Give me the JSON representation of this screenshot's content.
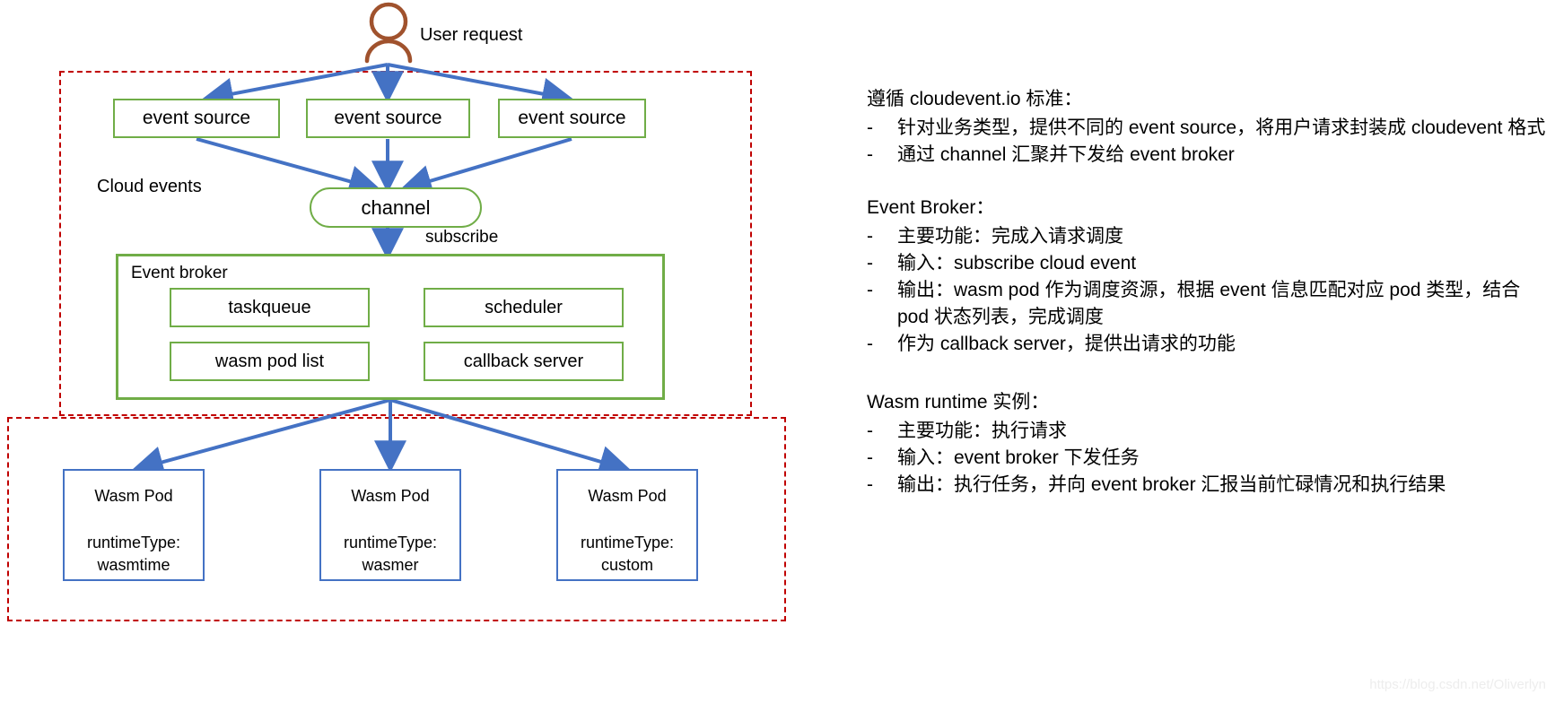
{
  "diagram": {
    "user_label": "User request",
    "cloud_events_label": "Cloud events",
    "subscribe_label": "subscribe",
    "event_sources": [
      "event source",
      "event source",
      "event source"
    ],
    "channel_label": "channel",
    "broker": {
      "title": "Event broker",
      "components": [
        "taskqueue",
        "scheduler",
        "wasm pod list",
        "callback server"
      ]
    },
    "pods": [
      {
        "title": "Wasm Pod",
        "runtime_key": "runtimeType:",
        "runtime_value": "wasmtime"
      },
      {
        "title": "Wasm Pod",
        "runtime_key": "runtimeType:",
        "runtime_value": "wasmer"
      },
      {
        "title": "Wasm Pod",
        "runtime_key": "runtimeType:",
        "runtime_value": "custom"
      }
    ]
  },
  "notes": {
    "sections": [
      {
        "heading": "遵循 cloudevent.io 标准：",
        "bullets": [
          {
            "marker": "-",
            "text": "针对业务类型，提供不同的 event source，将用户请求封装成 cloudevent 格式"
          },
          {
            "marker": "-",
            "text": "通过 channel 汇聚并下发给 event broker"
          }
        ]
      },
      {
        "heading": "Event Broker：",
        "bullets": [
          {
            "marker": "-",
            "text": "主要功能：完成入请求调度"
          },
          {
            "marker": "-",
            "text": "输入：subscribe cloud event"
          },
          {
            "marker": "-",
            "text": "输出：wasm pod 作为调度资源，根据 event 信息匹配对应 pod 类型，结合 pod 状态列表，完成调度"
          },
          {
            "marker": "-",
            "text": "作为 callback server，提供出请求的功能"
          }
        ]
      },
      {
        "heading": "Wasm runtime 实例：",
        "bullets": [
          {
            "marker": "-",
            "text": "主要功能：执行请求"
          },
          {
            "marker": "-",
            "text": "输入：event broker 下发任务"
          },
          {
            "marker": "-",
            "text": "输出：执行任务，并向 event broker 汇报当前忙碌情况和执行结果"
          }
        ]
      }
    ]
  },
  "watermark": "https://blog.csdn.net/Oliverlyn",
  "colors": {
    "green": "#70ad47",
    "blue": "#4472c4",
    "red_dashed": "#c00000",
    "person_brown": "#a0522d"
  }
}
